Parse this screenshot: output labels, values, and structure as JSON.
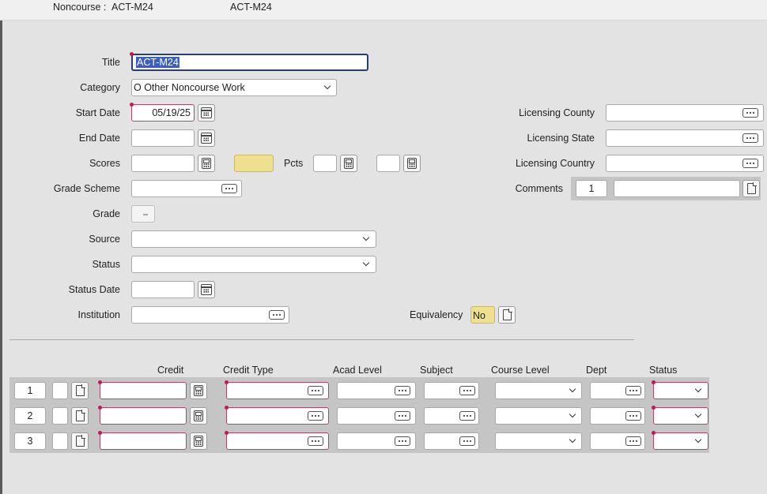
{
  "header": {
    "noncourse_label": "Noncourse :",
    "noncourse_value": "ACT-M24",
    "title_echo": "ACT-M24"
  },
  "form": {
    "title_label": "Title",
    "title_value": "ACT-M24",
    "category_label": "Category",
    "category_value": "O Other Noncourse Work",
    "start_date_label": "Start Date",
    "start_date_value": "05/19/25",
    "end_date_label": "End Date",
    "end_date_value": "",
    "scores_label": "Scores",
    "pcts_label": "Pcts",
    "grade_scheme_label": "Grade Scheme",
    "grade_label": "Grade",
    "source_label": "Source",
    "source_value": "",
    "status_label": "Status",
    "status_value": "",
    "status_date_label": "Status Date",
    "status_date_value": "",
    "institution_label": "Institution",
    "equivalency_label": "Equivalency",
    "equivalency_value": "No",
    "licensing_county_label": "Licensing County",
    "licensing_state_label": "Licensing State",
    "licensing_country_label": "Licensing Country",
    "comments_label": "Comments",
    "comments_count": "1"
  },
  "grid": {
    "columns": [
      "Credit",
      "Credit Type",
      "Acad Level",
      "Subject",
      "Course Level",
      "Dept",
      "Status"
    ],
    "rows": [
      {
        "num": "1"
      },
      {
        "num": "2"
      },
      {
        "num": "3"
      }
    ]
  },
  "colors": {
    "background": "#e3e3e3",
    "required_border": "#b5446a",
    "selection": "#3b5fc0",
    "highlight_yellow": "#eee08f"
  },
  "icons": [
    "calendar-icon",
    "calculator-icon",
    "ellipsis-icon",
    "chevron-down-icon",
    "document-icon"
  ]
}
